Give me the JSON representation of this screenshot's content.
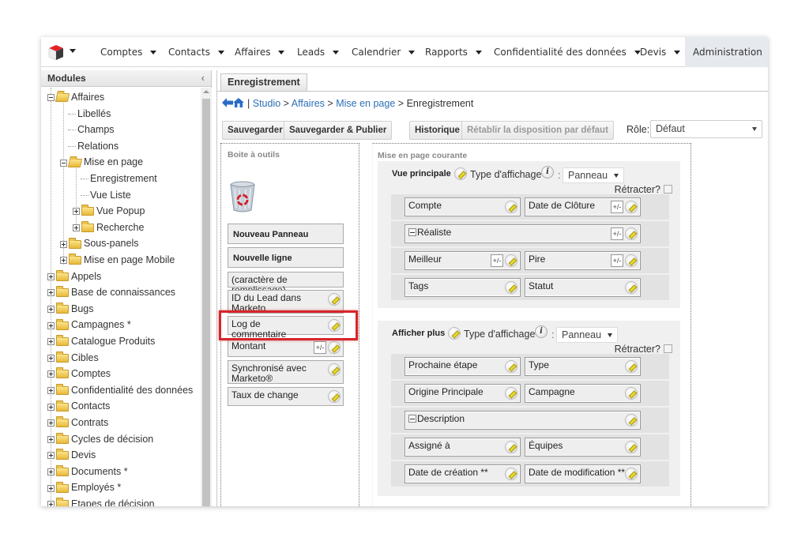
{
  "nav": {
    "items": [
      {
        "label": "Comptes"
      },
      {
        "label": "Contacts"
      },
      {
        "label": "Affaires"
      },
      {
        "label": "Leads"
      },
      {
        "label": "Calendrier"
      },
      {
        "label": "Rapports"
      },
      {
        "label": "Confidentialité des données"
      },
      {
        "label": "Devis"
      }
    ],
    "active": "Administration"
  },
  "sidebar": {
    "title": "Modules",
    "collapse_glyph": "‹",
    "tree": [
      {
        "label": "Affaires",
        "level": 0,
        "type": "folder-open",
        "toggle": "minus"
      },
      {
        "label": "Libellés",
        "level": 1,
        "type": "leaf"
      },
      {
        "label": "Champs",
        "level": 1,
        "type": "leaf"
      },
      {
        "label": "Relations",
        "level": 1,
        "type": "leaf"
      },
      {
        "label": "Mise en page",
        "level": 1,
        "type": "folder-open",
        "toggle": "minus"
      },
      {
        "label": "Enregistrement",
        "level": 2,
        "type": "leaf"
      },
      {
        "label": "Vue Liste",
        "level": 2,
        "type": "leaf"
      },
      {
        "label": "Vue Popup",
        "level": 2,
        "type": "folder",
        "toggle": "plus"
      },
      {
        "label": "Recherche",
        "level": 2,
        "type": "folder",
        "toggle": "plus"
      },
      {
        "label": "Sous-panels",
        "level": 1,
        "type": "folder",
        "toggle": "plus"
      },
      {
        "label": "Mise en page Mobile",
        "level": 1,
        "type": "folder",
        "toggle": "plus"
      },
      {
        "label": "Appels",
        "level": 0,
        "type": "folder",
        "toggle": "plus"
      },
      {
        "label": "Base de connaissances",
        "level": 0,
        "type": "folder",
        "toggle": "plus"
      },
      {
        "label": "Bugs",
        "level": 0,
        "type": "folder",
        "toggle": "plus"
      },
      {
        "label": "Campagnes *",
        "level": 0,
        "type": "folder",
        "toggle": "plus"
      },
      {
        "label": "Catalogue Produits",
        "level": 0,
        "type": "folder",
        "toggle": "plus"
      },
      {
        "label": "Cibles",
        "level": 0,
        "type": "folder",
        "toggle": "plus"
      },
      {
        "label": "Comptes",
        "level": 0,
        "type": "folder",
        "toggle": "plus"
      },
      {
        "label": "Confidentialité des données",
        "level": 0,
        "type": "folder",
        "toggle": "plus"
      },
      {
        "label": "Contacts",
        "level": 0,
        "type": "folder",
        "toggle": "plus"
      },
      {
        "label": "Contrats",
        "level": 0,
        "type": "folder",
        "toggle": "plus"
      },
      {
        "label": "Cycles de décision",
        "level": 0,
        "type": "folder",
        "toggle": "plus"
      },
      {
        "label": "Devis",
        "level": 0,
        "type": "folder",
        "toggle": "plus"
      },
      {
        "label": "Documents *",
        "level": 0,
        "type": "folder",
        "toggle": "plus"
      },
      {
        "label": "Employés *",
        "level": 0,
        "type": "folder",
        "toggle": "plus"
      },
      {
        "label": "Etapes de décision",
        "level": 0,
        "type": "folder",
        "toggle": "plus"
      }
    ]
  },
  "main": {
    "tab": "Enregistrement",
    "breadcrumb": {
      "sep": "|",
      "links": [
        "Studio",
        "Affaires",
        "Mise en page"
      ],
      "current": "Enregistrement",
      "arrow": ">"
    },
    "buttons": {
      "save": "Sauvegarder",
      "save_publish": "Sauvegarder & Publier",
      "history": "Historique",
      "reset": "Rétablir la disposition par défaut"
    },
    "role": {
      "label": "Rôle:",
      "value": "Défaut"
    },
    "toolbox": {
      "title": "Boite à outils",
      "new_panel": "Nouveau Panneau",
      "new_row": "Nouvelle ligne",
      "filler": "(caractère de remplissage)",
      "fields": [
        {
          "label": "ID du Lead dans Marketo",
          "calc": false
        },
        {
          "label": "Log de commentaire",
          "calc": false,
          "highlighted": true
        },
        {
          "label": "Montant",
          "calc": true
        },
        {
          "label": "Synchronisé avec Marketo®",
          "calc": false
        },
        {
          "label": "Taux de change",
          "calc": false
        }
      ]
    },
    "layout": {
      "title": "Mise en page courante",
      "type_label": "Type d'affichage",
      "info_glyph": "i",
      "colon": ":",
      "retract_label": "Rétracter?",
      "calc_glyph": "+/-",
      "panels": [
        {
          "name": "Vue principale",
          "display_type": "Panneau",
          "retract": false,
          "rows": [
            [
              {
                "label": "Compte",
                "calc": false
              },
              {
                "label": "Date de Clôture",
                "calc": true
              }
            ],
            [
              {
                "label": "Réaliste",
                "calc": true,
                "full": true
              }
            ],
            [
              {
                "label": "Meilleur",
                "calc": true
              },
              {
                "label": "Pire",
                "calc": true
              }
            ],
            [
              {
                "label": "Tags",
                "calc": false
              },
              {
                "label": "Statut",
                "calc": false
              }
            ]
          ]
        },
        {
          "name": "Afficher plus",
          "display_type": "Panneau",
          "retract": false,
          "rows": [
            [
              {
                "label": "Prochaine étape",
                "calc": false
              },
              {
                "label": "Type",
                "calc": false
              }
            ],
            [
              {
                "label": "Origine Principale",
                "calc": false
              },
              {
                "label": "Campagne",
                "calc": false
              }
            ],
            [
              {
                "label": "Description",
                "calc": false,
                "full": true
              }
            ],
            [
              {
                "label": "Assigné à",
                "calc": false
              },
              {
                "label": "Équipes",
                "calc": false
              }
            ],
            [
              {
                "label": "Date de création **",
                "calc": false
              },
              {
                "label": "Date de modification **",
                "calc": false
              }
            ]
          ]
        }
      ]
    }
  },
  "colors": {
    "link": "#2c6fb6",
    "highlight": "#d6262a",
    "nav_active_bg": "#e6e9ee"
  }
}
